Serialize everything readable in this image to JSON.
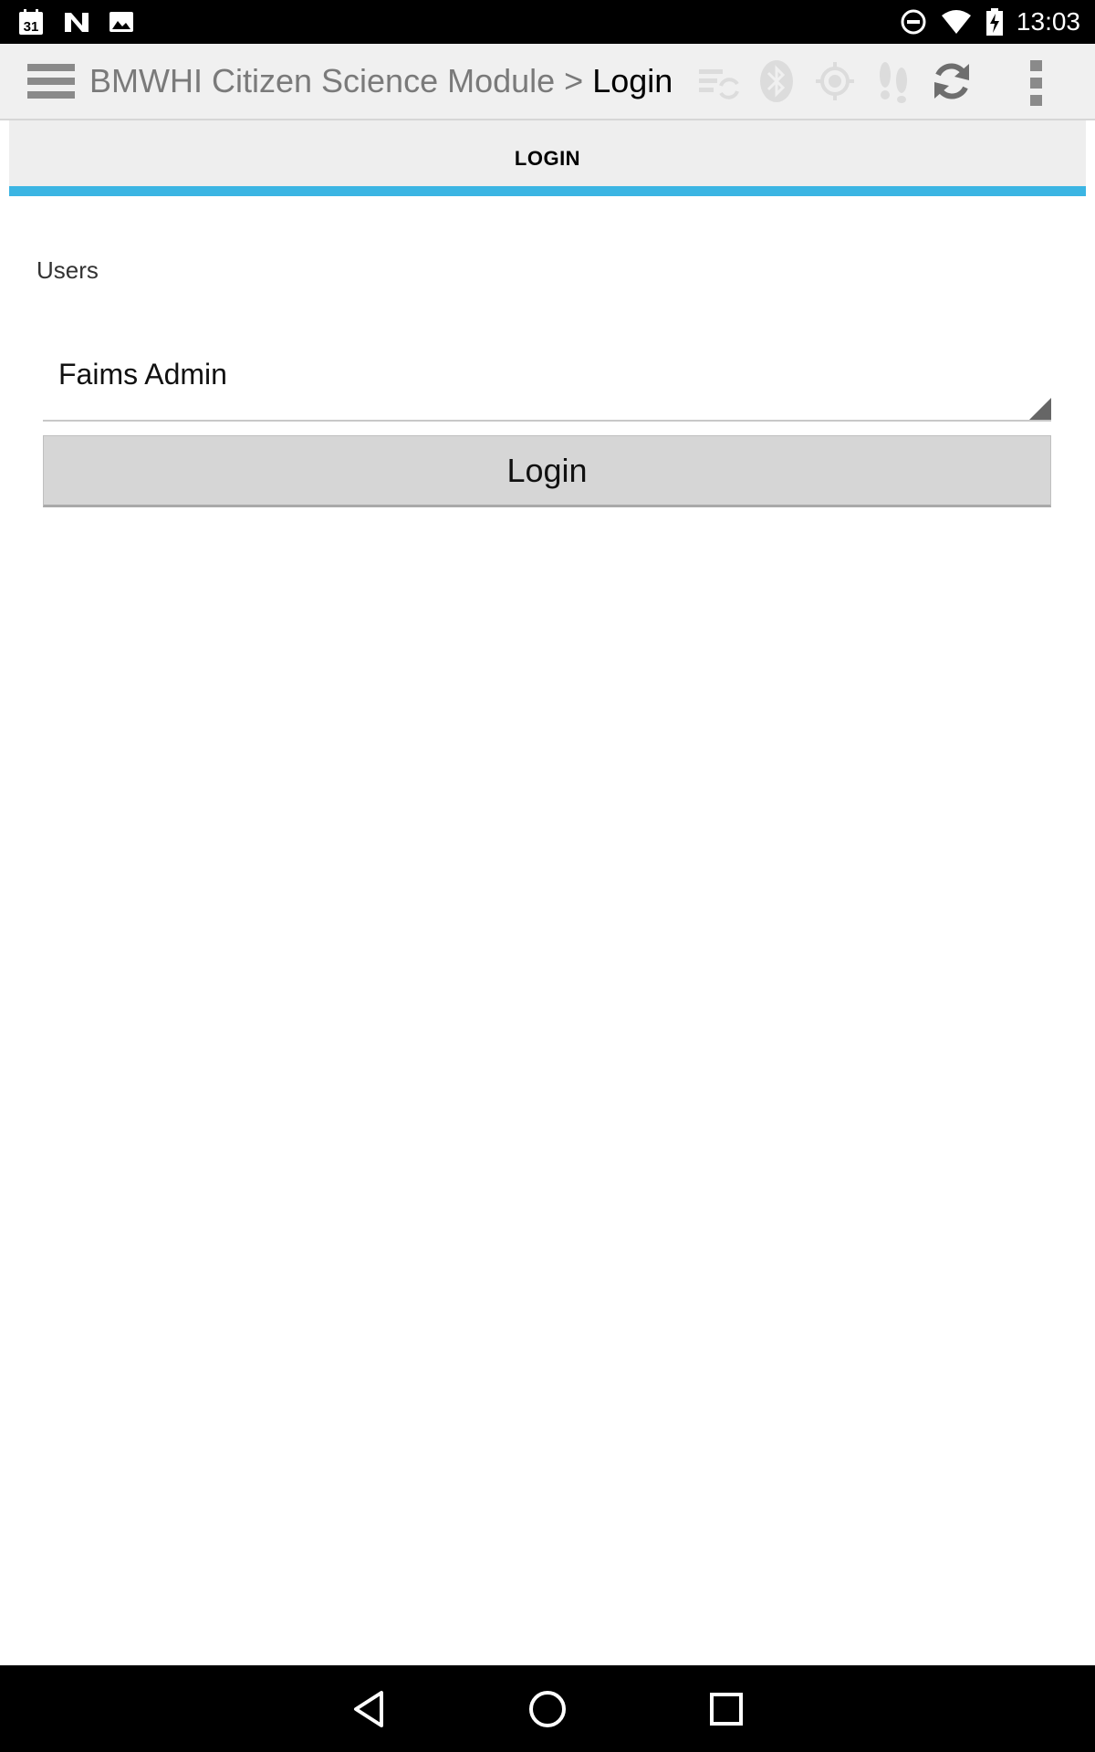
{
  "status_bar": {
    "time": "13:03",
    "left_icons": [
      "calendar-icon",
      "n-app-icon",
      "image-icon"
    ],
    "calendar_day": "31",
    "right_icons": [
      "do-not-disturb-icon",
      "wifi-icon",
      "battery-charging-icon"
    ]
  },
  "action_bar": {
    "title_module": "BMWHI Citizen Science Module",
    "title_separator": " > ",
    "title_page": "Login",
    "icons": [
      "sync-list-icon",
      "bluetooth-icon",
      "gps-icon",
      "footsteps-icon",
      "refresh-icon"
    ],
    "menu_icon": "hamburger-menu-icon",
    "overflow_icon": "overflow-menu-icon"
  },
  "tab": {
    "label": "LOGIN",
    "indicator_color": "#3bb5e3"
  },
  "form": {
    "users_label": "Users",
    "selected_user": "Faims Admin",
    "login_button": "Login"
  },
  "nav_bar": {
    "buttons": [
      "back-icon",
      "home-icon",
      "recents-icon"
    ]
  }
}
